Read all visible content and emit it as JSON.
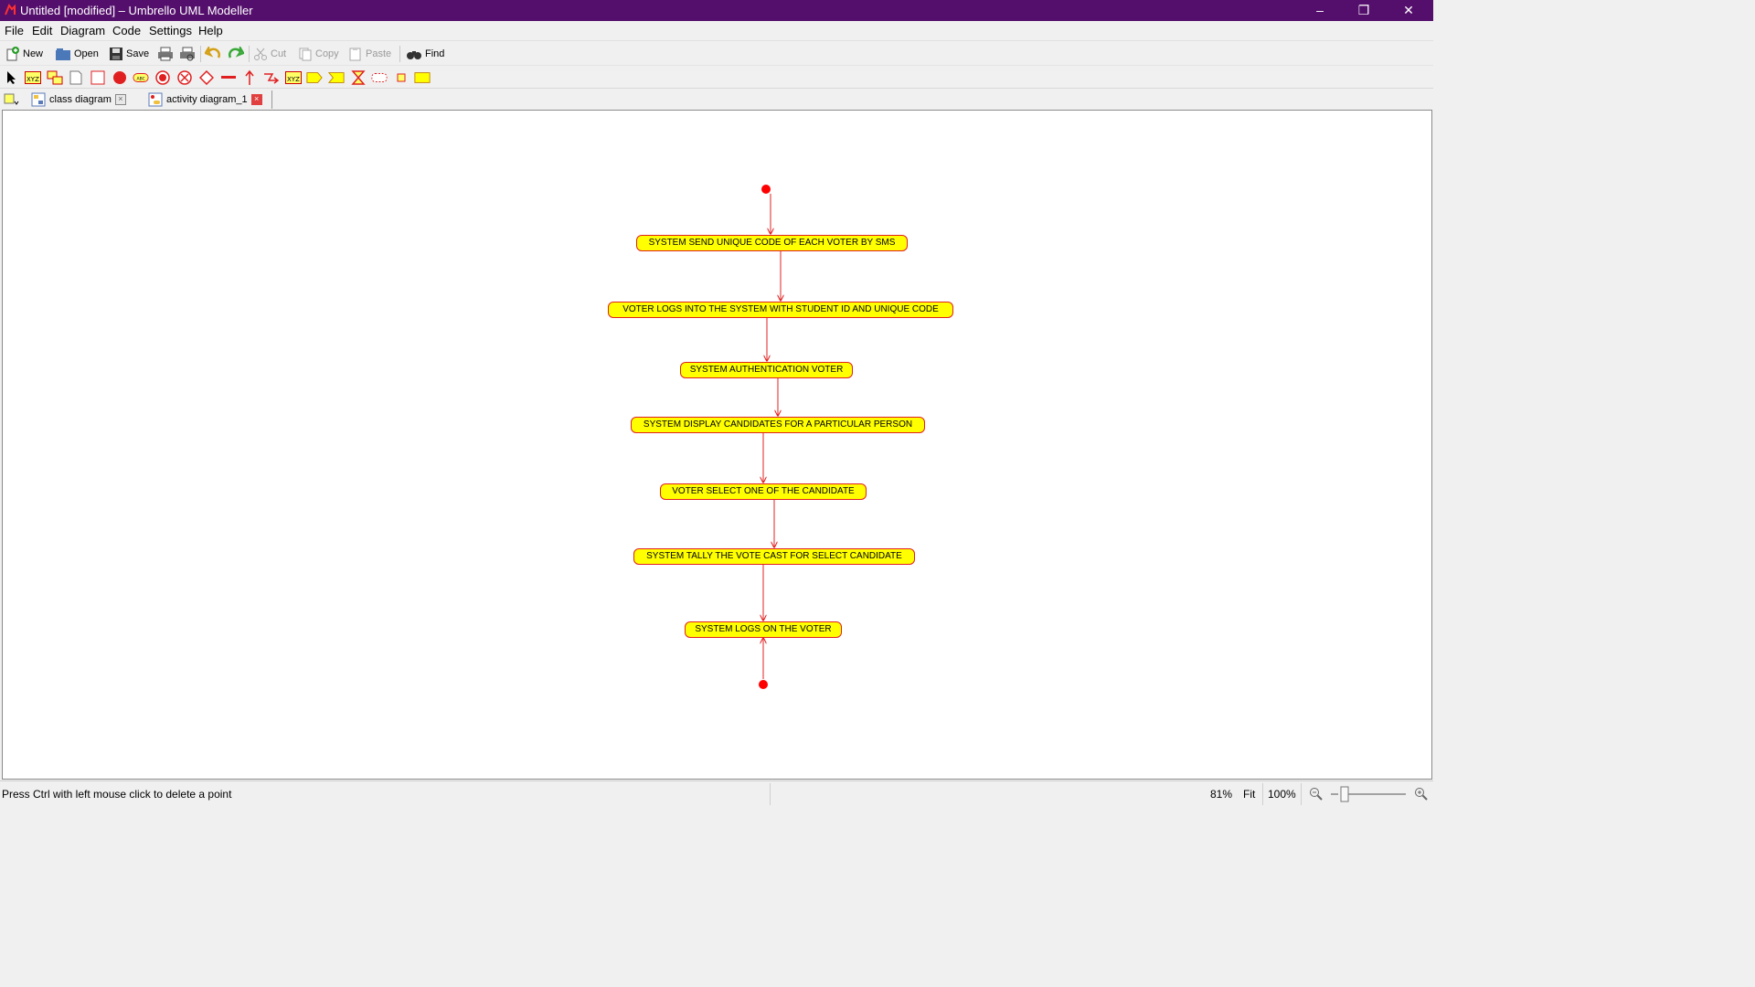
{
  "window": {
    "title": "Untitled [modified] – Umbrello UML Modeller",
    "min_label": "–",
    "restore_label": "❐",
    "close_label": "✕"
  },
  "menu": [
    "File",
    "Edit",
    "Diagram",
    "Code",
    "Settings",
    "Help"
  ],
  "toolbar": {
    "new": "New",
    "open": "Open",
    "save": "Save",
    "cut": "Cut",
    "copy": "Copy",
    "paste": "Paste",
    "find": "Find"
  },
  "tabs": [
    {
      "label": "class diagram",
      "active": false
    },
    {
      "label": "activity diagram_1",
      "active": true
    }
  ],
  "diagram": {
    "activities": [
      "SYSTEM SEND UNIQUE CODE OF EACH VOTER BY SMS",
      "VOTER LOGS INTO THE SYSTEM WITH STUDENT ID AND UNIQUE CODE",
      "SYSTEM AUTHENTICATION VOTER",
      "SYSTEM DISPLAY CANDIDATES FOR A PARTICULAR PERSON",
      "VOTER SELECT ONE OF THE CANDIDATE",
      "SYSTEM TALLY THE VOTE CAST FOR SELECT CANDIDATE",
      "SYSTEM LOGS ON THE VOTER"
    ],
    "colors": {
      "fill": "#ffff00",
      "border": "#e02020",
      "node": "#ff0000"
    }
  },
  "status": {
    "message": "Press Ctrl with left mouse click to delete a point",
    "zoom": "81%",
    "fit": "Fit",
    "zoom_100": "100%"
  },
  "colors": {
    "titlebar": "#540f6c"
  }
}
